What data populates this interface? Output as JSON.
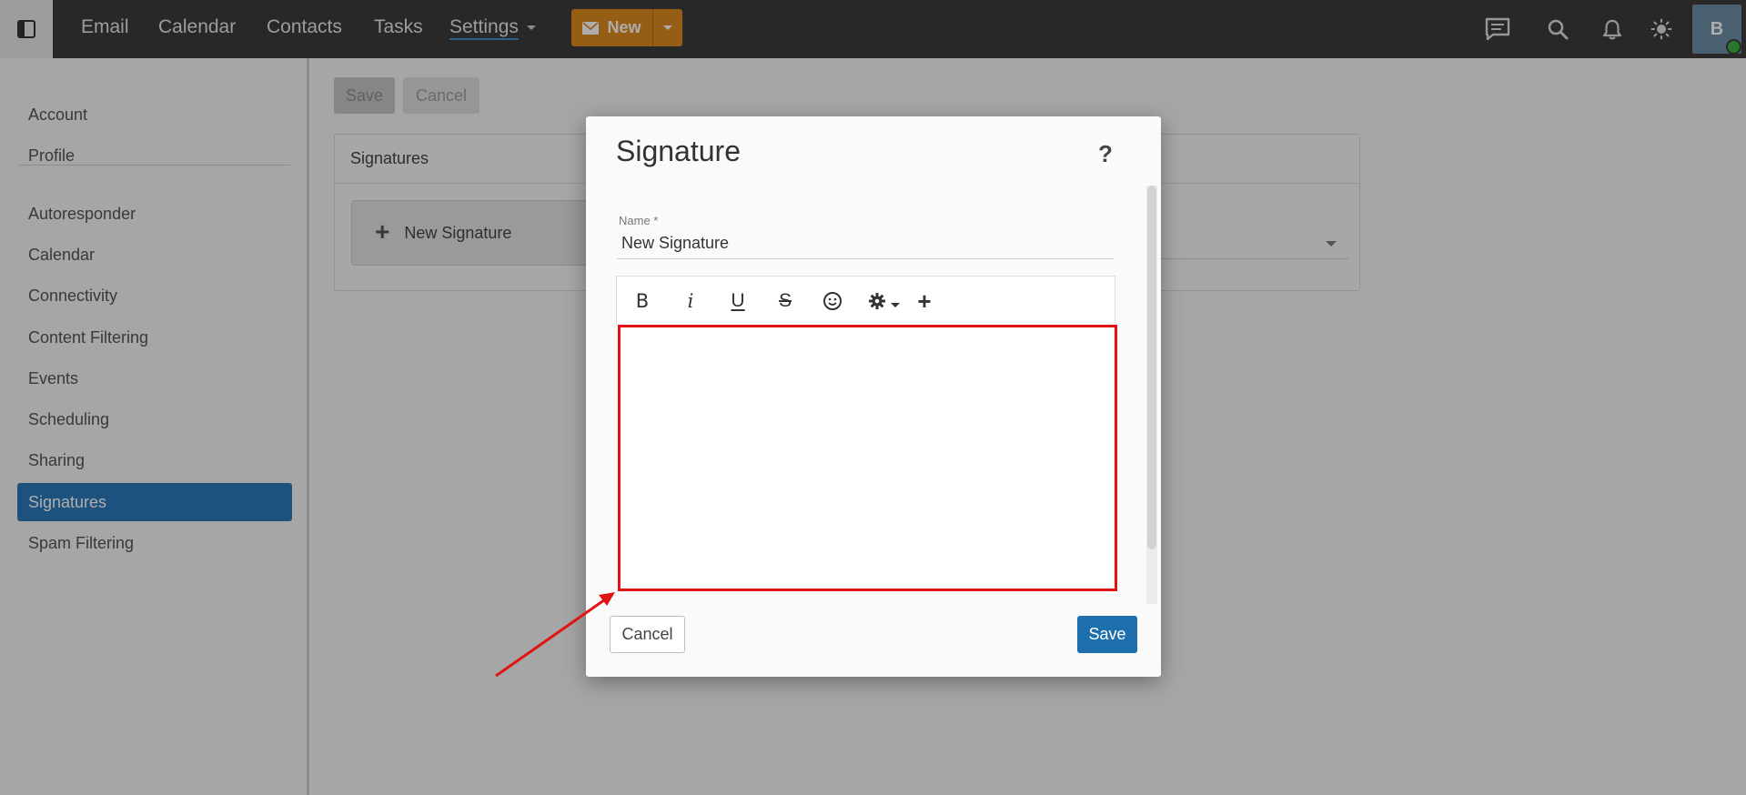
{
  "topbar": {
    "nav": [
      "Email",
      "Calendar",
      "Contacts",
      "Tasks",
      "Settings"
    ],
    "new_label": "New",
    "avatar_initial": "B"
  },
  "page": {
    "save_label": "Save",
    "cancel_label": "Cancel",
    "panel_title": "Signatures",
    "new_signature_label": "New Signature"
  },
  "sidebar": {
    "items": [
      "Account",
      "Profile",
      "Autoresponder",
      "Calendar",
      "Connectivity",
      "Content Filtering",
      "Events",
      "Scheduling",
      "Sharing",
      "Signatures",
      "Spam Filtering"
    ],
    "active": "Signatures"
  },
  "modal": {
    "title": "Signature",
    "help": "?",
    "name_label": "Name *",
    "name_value": "New Signature",
    "toolbar": [
      "bold",
      "italic",
      "underline",
      "strikethrough",
      "emoji",
      "settings",
      "insert"
    ],
    "cancel_label": "Cancel",
    "save_label": "Save"
  },
  "colors": {
    "topbar": "#3b3b3b",
    "new_button": "#dd8a1e",
    "active_item": "#2a7ab8",
    "save_button": "#1e6fad",
    "annotation": "#e11414"
  }
}
